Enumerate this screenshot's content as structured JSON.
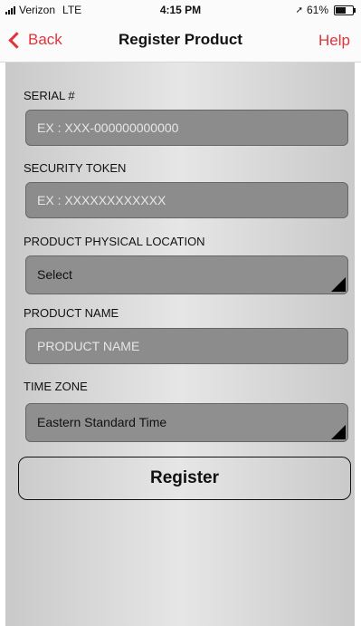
{
  "status_bar": {
    "carrier": "Verizon",
    "network": "LTE",
    "time": "4:15 PM",
    "battery_percent": "61%",
    "battery_level": 0.61
  },
  "nav": {
    "back_label": "Back",
    "title": "Register Product",
    "help_label": "Help",
    "accent_color": "#e0343a"
  },
  "form": {
    "serial": {
      "label": "SERIAL #",
      "value": "",
      "placeholder": "EX : XXX-000000000000"
    },
    "security_token": {
      "label": "SECURITY TOKEN",
      "value": "",
      "placeholder": "EX : XXXXXXXXXXXX"
    },
    "location": {
      "label": "PRODUCT PHYSICAL LOCATION",
      "selected": "Select"
    },
    "product_name": {
      "label": "PRODUCT NAME",
      "value": "",
      "placeholder": "PRODUCT NAME"
    },
    "time_zone": {
      "label": "TIME ZONE",
      "selected": "Eastern Standard Time"
    },
    "register_label": "Register"
  }
}
